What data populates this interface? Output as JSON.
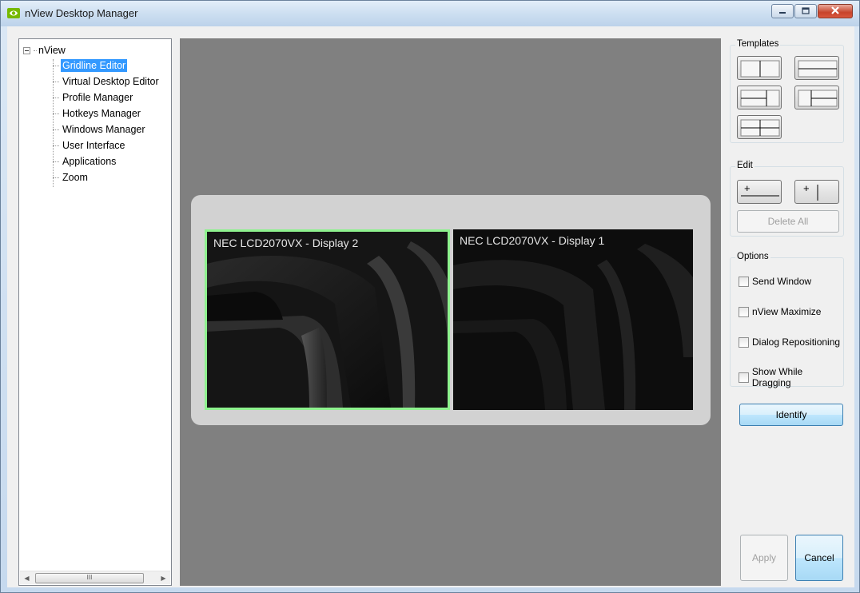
{
  "window": {
    "title": "nView Desktop Manager"
  },
  "tree": {
    "root": "nView",
    "items": [
      {
        "label": "Gridline Editor",
        "selected": true
      },
      {
        "label": "Virtual Desktop Editor"
      },
      {
        "label": "Profile Manager"
      },
      {
        "label": "Hotkeys Manager"
      },
      {
        "label": "Windows Manager"
      },
      {
        "label": "User Interface"
      },
      {
        "label": "Applications"
      },
      {
        "label": "Zoom"
      }
    ],
    "scroll_thumb_glyph": "III"
  },
  "displays": [
    {
      "label": "NEC LCD2070VX - Display 2",
      "selected": true
    },
    {
      "label": "NEC LCD2070VX - Display 1",
      "selected": false
    }
  ],
  "templates": {
    "title": "Templates",
    "buttons": [
      "vertical-split",
      "horizontal-split",
      "horizontal-split-left-divider",
      "horizontal-split-right-divider",
      "cross-split"
    ]
  },
  "edit": {
    "title": "Edit",
    "add_horizontal_glyph": "+",
    "add_vertical_glyph": "+",
    "delete_all_label": "Delete All"
  },
  "options": {
    "title": "Options",
    "items": [
      {
        "label": "Send Window",
        "checked": false
      },
      {
        "label": "nView Maximize",
        "checked": false
      },
      {
        "label": "Dialog Repositioning",
        "checked": false
      },
      {
        "label": "Show While Dragging",
        "checked": false
      }
    ]
  },
  "actions": {
    "identify_label": "Identify",
    "apply_label": "Apply",
    "cancel_label": "Cancel"
  },
  "colors": {
    "selected_display_border": "#8ef28e",
    "tree_selection": "#3399ff",
    "canvas_background": "#808080"
  }
}
